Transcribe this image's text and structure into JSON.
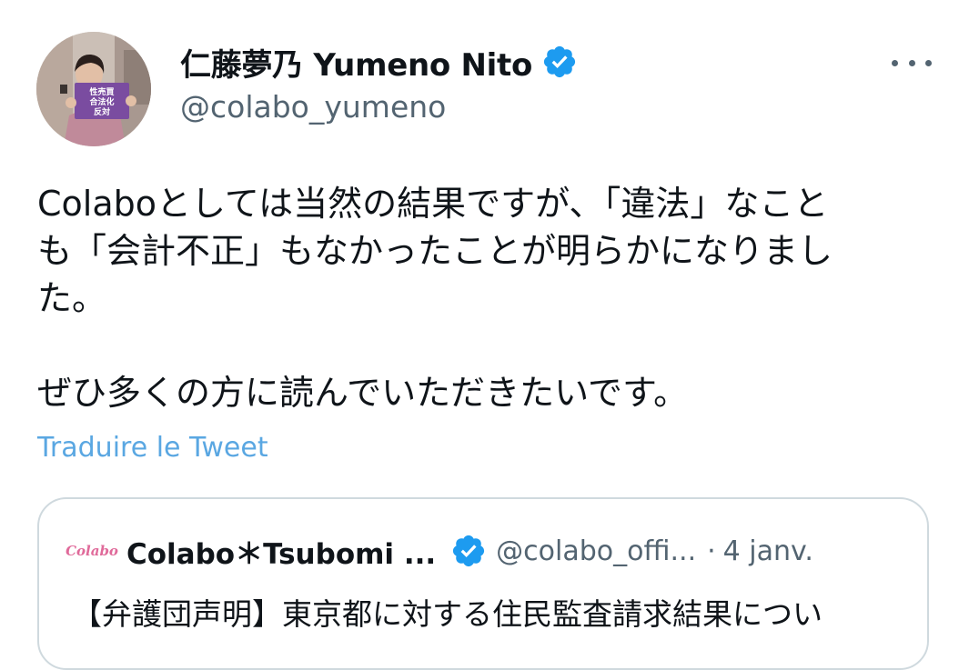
{
  "author": {
    "display_name": "仁藤夢乃 Yumeno Nito",
    "handle": "@colabo_yumeno",
    "avatar_sign_text": "性売買\n合法化\n反対"
  },
  "tweet": {
    "lines": [
      "Colaboとしては当然の結果ですが、「違法」なこと",
      "も「会計不正」もなかったことが明らかになりまし",
      "た。",
      "ぜひ多くの方に読んでいただきたいです。"
    ],
    "translate_label": "Traduire le Tweet"
  },
  "quote": {
    "logo_text": "Colabo",
    "name": "Colabo＊Tsubomi ...",
    "handle": "@colabo_offi...",
    "separator": "·",
    "date": "4 janv.",
    "text": "【弁護団声明】東京都に対する住民監査請求結果につい"
  },
  "colors": {
    "verified_blue": "#1d9bf0",
    "link_blue": "#5aa7e2",
    "text_primary": "#0f1419",
    "text_secondary": "#536471",
    "border": "#cfd9de"
  },
  "icons": {
    "verified": "verified-badge-icon",
    "more": "more-horizontal-icon"
  }
}
